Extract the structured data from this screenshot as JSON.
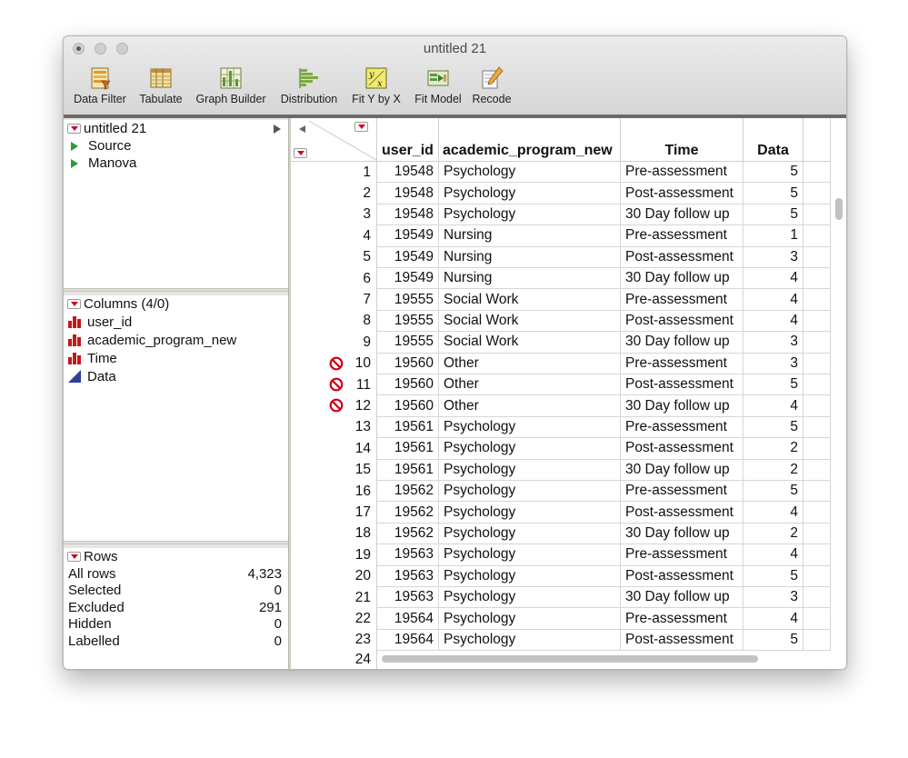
{
  "window": {
    "title": "untitled 21"
  },
  "toolbar": [
    {
      "label": "Data Filter",
      "icon": "data-filter-icon"
    },
    {
      "label": "Tabulate",
      "icon": "tabulate-icon"
    },
    {
      "label": "Graph Builder",
      "icon": "graph-builder-icon"
    },
    {
      "label": "Distribution",
      "icon": "distribution-icon"
    },
    {
      "label": "Fit Y by X",
      "icon": "fit-y-by-x-icon"
    },
    {
      "label": "Fit Model",
      "icon": "fit-model-icon"
    },
    {
      "label": "Recode",
      "icon": "recode-icon"
    }
  ],
  "table_panel": {
    "title": "untitled 21",
    "items": [
      "Source",
      "Manova"
    ]
  },
  "columns_panel": {
    "title": "Columns (4/0)",
    "items": [
      {
        "name": "user_id",
        "type": "nominal"
      },
      {
        "name": "academic_program_new",
        "type": "nominal"
      },
      {
        "name": "Time",
        "type": "nominal"
      },
      {
        "name": "Data",
        "type": "continuous"
      }
    ]
  },
  "rows_panel": {
    "title": "Rows",
    "stats": [
      {
        "label": "All rows",
        "value": "4,323"
      },
      {
        "label": "Selected",
        "value": "0"
      },
      {
        "label": "Excluded",
        "value": "291"
      },
      {
        "label": "Hidden",
        "value": "0"
      },
      {
        "label": "Labelled",
        "value": "0"
      }
    ]
  },
  "grid": {
    "headers": [
      "user_id",
      "academic_program_new",
      "Time",
      "Data"
    ],
    "rows": [
      {
        "n": "1",
        "excluded": false,
        "cells": [
          "19548",
          "Psychology",
          "Pre-assessment",
          "5"
        ]
      },
      {
        "n": "2",
        "excluded": false,
        "cells": [
          "19548",
          "Psychology",
          "Post-assessment",
          "5"
        ]
      },
      {
        "n": "3",
        "excluded": false,
        "cells": [
          "19548",
          "Psychology",
          "30 Day follow up",
          "5"
        ]
      },
      {
        "n": "4",
        "excluded": false,
        "cells": [
          "19549",
          "Nursing",
          "Pre-assessment",
          "1"
        ]
      },
      {
        "n": "5",
        "excluded": false,
        "cells": [
          "19549",
          "Nursing",
          "Post-assessment",
          "3"
        ]
      },
      {
        "n": "6",
        "excluded": false,
        "cells": [
          "19549",
          "Nursing",
          "30 Day follow up",
          "4"
        ]
      },
      {
        "n": "7",
        "excluded": false,
        "cells": [
          "19555",
          "Social Work",
          "Pre-assessment",
          "4"
        ]
      },
      {
        "n": "8",
        "excluded": false,
        "cells": [
          "19555",
          "Social Work",
          "Post-assessment",
          "4"
        ]
      },
      {
        "n": "9",
        "excluded": false,
        "cells": [
          "19555",
          "Social Work",
          "30 Day follow up",
          "3"
        ]
      },
      {
        "n": "10",
        "excluded": true,
        "cells": [
          "19560",
          "Other",
          "Pre-assessment",
          "3"
        ]
      },
      {
        "n": "11",
        "excluded": true,
        "cells": [
          "19560",
          "Other",
          "Post-assessment",
          "5"
        ]
      },
      {
        "n": "12",
        "excluded": true,
        "cells": [
          "19560",
          "Other",
          "30 Day follow up",
          "4"
        ]
      },
      {
        "n": "13",
        "excluded": false,
        "cells": [
          "19561",
          "Psychology",
          "Pre-assessment",
          "5"
        ]
      },
      {
        "n": "14",
        "excluded": false,
        "cells": [
          "19561",
          "Psychology",
          "Post-assessment",
          "2"
        ]
      },
      {
        "n": "15",
        "excluded": false,
        "cells": [
          "19561",
          "Psychology",
          "30 Day follow up",
          "2"
        ]
      },
      {
        "n": "16",
        "excluded": false,
        "cells": [
          "19562",
          "Psychology",
          "Pre-assessment",
          "5"
        ]
      },
      {
        "n": "17",
        "excluded": false,
        "cells": [
          "19562",
          "Psychology",
          "Post-assessment",
          "4"
        ]
      },
      {
        "n": "18",
        "excluded": false,
        "cells": [
          "19562",
          "Psychology",
          "30 Day follow up",
          "2"
        ]
      },
      {
        "n": "19",
        "excluded": false,
        "cells": [
          "19563",
          "Psychology",
          "Pre-assessment",
          "4"
        ]
      },
      {
        "n": "20",
        "excluded": false,
        "cells": [
          "19563",
          "Psychology",
          "Post-assessment",
          "5"
        ]
      },
      {
        "n": "21",
        "excluded": false,
        "cells": [
          "19563",
          "Psychology",
          "30 Day follow up",
          "3"
        ]
      },
      {
        "n": "22",
        "excluded": false,
        "cells": [
          "19564",
          "Psychology",
          "Pre-assessment",
          "4"
        ]
      },
      {
        "n": "23",
        "excluded": false,
        "cells": [
          "19564",
          "Psychology",
          "Post-assessment",
          "5"
        ]
      }
    ],
    "partial_row": "24"
  }
}
